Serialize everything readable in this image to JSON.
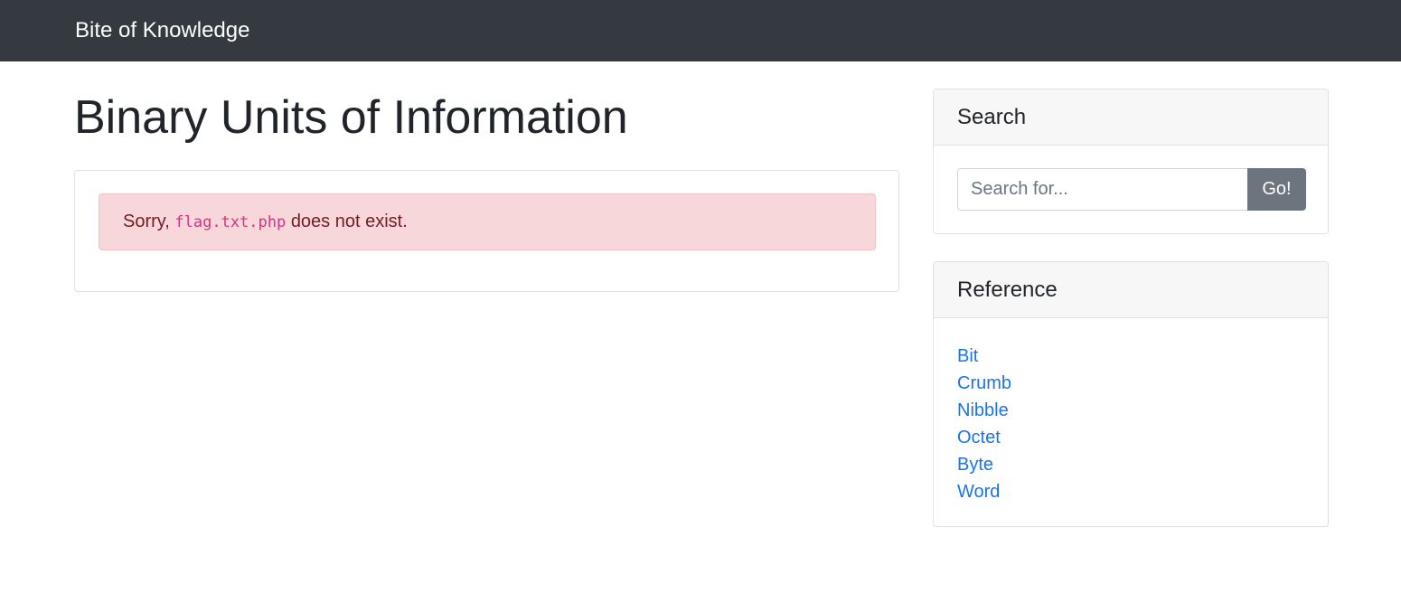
{
  "navbar": {
    "brand": "Bite of Knowledge"
  },
  "main": {
    "title": "Binary Units of Information",
    "alert": {
      "prefix": "Sorry,",
      "filename": "flag.txt.php",
      "suffix": "does not exist."
    }
  },
  "sidebar": {
    "search": {
      "title": "Search",
      "placeholder": "Search for...",
      "button_label": "Go!"
    },
    "reference": {
      "title": "Reference",
      "links": [
        "Bit",
        "Crumb",
        "Nibble",
        "Octet",
        "Byte",
        "Word"
      ]
    }
  },
  "colors": {
    "navbar_bg": "#343a40",
    "alert_bg": "#f8d7da",
    "alert_text": "#721c24",
    "code_text": "#d63384",
    "link": "#1a73e8",
    "button_bg": "#6c757d"
  }
}
